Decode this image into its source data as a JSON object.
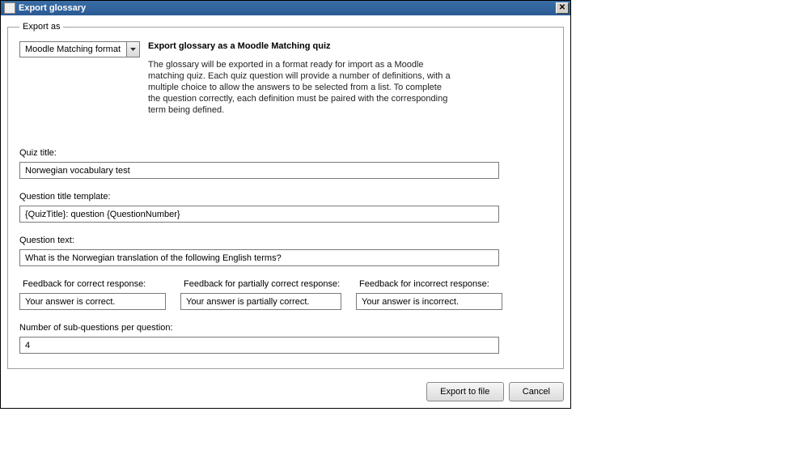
{
  "window": {
    "title": "Export glossary"
  },
  "fieldset": {
    "legend": "Export as"
  },
  "format": {
    "selected": "Moodle Matching format"
  },
  "description": {
    "heading": "Export glossary as a Moodle Matching quiz",
    "body": "The glossary will be exported in a format ready for import as a Moodle matching quiz. Each quiz question will provide a number of definitions, with a multiple choice to allow the answers to be selected from a list. To complete the question correctly, each definition must be paired with the corresponding term being defined."
  },
  "labels": {
    "quiz_title": "Quiz title:",
    "question_title_template": "Question title template:",
    "question_text": "Question text:",
    "feedback_correct": "Feedback for correct response:",
    "feedback_partial": "Feedback for partially correct response:",
    "feedback_incorrect": "Feedback for incorrect response:",
    "num_subquestions": "Number of sub-questions per question:"
  },
  "values": {
    "quiz_title": "Norwegian vocabulary test",
    "question_title_template": "{QuizTitle}: question {QuestionNumber}",
    "question_text": "What is the Norwegian translation of the following English terms?",
    "feedback_correct": "Your answer is correct.",
    "feedback_partial": "Your answer is partially correct.",
    "feedback_incorrect": "Your answer is incorrect.",
    "num_subquestions": "4"
  },
  "buttons": {
    "export": "Export to file",
    "cancel": "Cancel"
  }
}
